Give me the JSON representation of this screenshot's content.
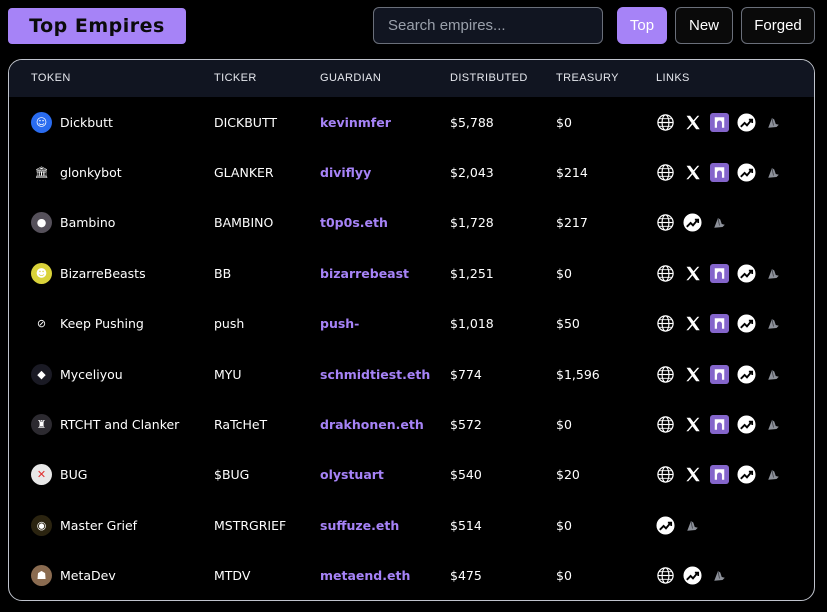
{
  "header": {
    "logo": "Top Empires",
    "search_placeholder": "Search empires...",
    "filters": [
      {
        "label": "Top",
        "active": true
      },
      {
        "label": "New",
        "active": false
      },
      {
        "label": "Forged",
        "active": false
      }
    ]
  },
  "table": {
    "columns": [
      "TOKEN",
      "TICKER",
      "GUARDIAN",
      "DISTRIBUTED",
      "TREASURY",
      "LINKS"
    ],
    "rows": [
      {
        "token": "Dickbutt",
        "ticker": "DICKBUTT",
        "guardian": "kevinmfer",
        "distributed": "$5,788",
        "treasury": "$0",
        "icon": "dickbutt-avatar",
        "icon_bg": "#2a6cf0",
        "links": [
          "globe",
          "x",
          "farcaster",
          "dexscreener",
          "clanker"
        ]
      },
      {
        "token": "glonkybot",
        "ticker": "GLANKER",
        "guardian": "diviflyy",
        "distributed": "$2,043",
        "treasury": "$214",
        "icon": "bank-icon",
        "icon_bg": "#000000",
        "links": [
          "globe",
          "x",
          "farcaster",
          "dexscreener",
          "clanker"
        ]
      },
      {
        "token": "Bambino",
        "ticker": "BAMBINO",
        "guardian": "t0p0s.eth",
        "distributed": "$1,728",
        "treasury": "$217",
        "icon": "bambino-avatar",
        "icon_bg": "#55505a",
        "links": [
          "globe",
          "dexscreener",
          "clanker"
        ]
      },
      {
        "token": "BizarreBeasts",
        "ticker": "BB",
        "guardian": "bizarrebeast",
        "distributed": "$1,251",
        "treasury": "$0",
        "icon": "bizarrebeasts-avatar",
        "icon_bg": "#d9d23a",
        "links": [
          "globe",
          "x",
          "farcaster",
          "dexscreener",
          "clanker"
        ]
      },
      {
        "token": "Keep Pushing",
        "ticker": "push",
        "guardian": "push-",
        "distributed": "$1,018",
        "treasury": "$50",
        "icon": "keep-pushing-avatar",
        "icon_bg": "#000000",
        "links": [
          "globe",
          "x",
          "farcaster",
          "dexscreener",
          "clanker"
        ]
      },
      {
        "token": "Myceliyou",
        "ticker": "MYU",
        "guardian": "schmidtiest.eth",
        "distributed": "$774",
        "treasury": "$1,596",
        "icon": "myceliyou-avatar",
        "icon_bg": "#1a1a24",
        "links": [
          "globe",
          "x",
          "farcaster",
          "dexscreener",
          "clanker"
        ]
      },
      {
        "token": "RTCHT and Clanker",
        "ticker": "RaTcHeT",
        "guardian": "drakhonen.eth",
        "distributed": "$572",
        "treasury": "$0",
        "icon": "ratchet-avatar",
        "icon_bg": "#2c2a30",
        "links": [
          "globe",
          "x",
          "farcaster",
          "dexscreener",
          "clanker"
        ]
      },
      {
        "token": "BUG",
        "ticker": "$BUG",
        "guardian": "olystuart",
        "distributed": "$540",
        "treasury": "$20",
        "icon": "bug-avatar",
        "icon_bg": "#e8e8e8",
        "links": [
          "globe",
          "x",
          "farcaster",
          "dexscreener",
          "clanker"
        ]
      },
      {
        "token": "Master Grief",
        "ticker": "MSTRGRIEF",
        "guardian": "suffuze.eth",
        "distributed": "$514",
        "treasury": "$0",
        "icon": "master-grief-avatar",
        "icon_bg": "#2b2410",
        "links": [
          "dexscreener",
          "clanker"
        ]
      },
      {
        "token": "MetaDev",
        "ticker": "MTDV",
        "guardian": "metaend.eth",
        "distributed": "$475",
        "treasury": "$0",
        "icon": "metadev-avatar",
        "icon_bg": "#8a6b50",
        "links": [
          "globe",
          "dexscreener",
          "clanker"
        ]
      }
    ]
  },
  "colors": {
    "accent": "#a683f7",
    "header_bg": "#111521",
    "farcaster": "#8465cb"
  }
}
